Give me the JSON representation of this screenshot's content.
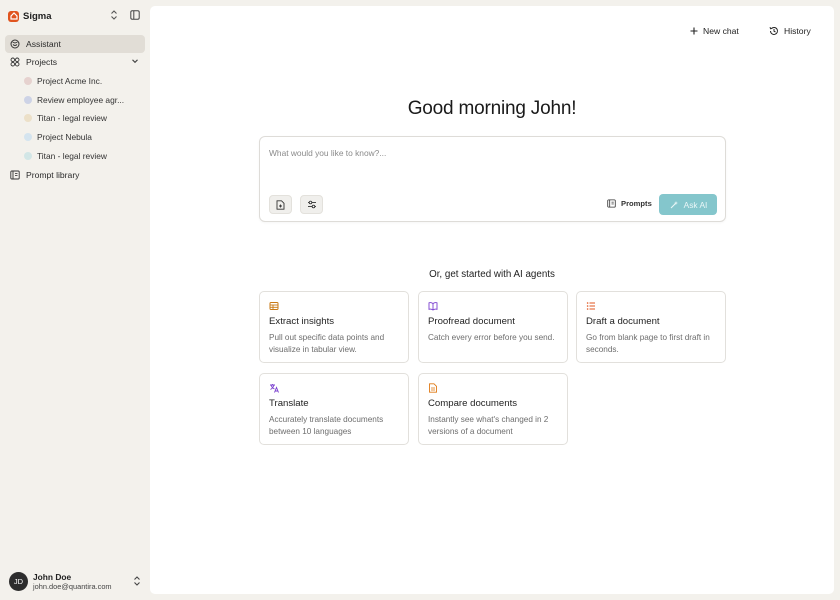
{
  "workspace": {
    "name": "Sigma",
    "logo_color": "#e0541f"
  },
  "sidebar": {
    "assistant_label": "Assistant",
    "projects_label": "Projects",
    "projects": [
      {
        "label": "Project Acme Inc.",
        "color": "#e6d2cf"
      },
      {
        "label": "Review employee agr...",
        "color": "#cdd3e6"
      },
      {
        "label": "Titan - legal review",
        "color": "#ece0c8"
      },
      {
        "label": "Project Nebula",
        "color": "#d4e4ef"
      },
      {
        "label": "Titan - legal review",
        "color": "#d2e6e6"
      }
    ],
    "prompt_library_label": "Prompt library"
  },
  "user": {
    "initials": "JD",
    "name": "John Doe",
    "email": "john.doe@quantira.com"
  },
  "header": {
    "new_chat_label": "New chat",
    "history_label": "History"
  },
  "greeting": "Good morning John!",
  "prompt": {
    "placeholder": "What would you like to know?...",
    "prompts_label": "Prompts",
    "ask_label": "Ask AI",
    "ask_color": "#84c6cc"
  },
  "agents": {
    "heading": "Or, get started with AI agents",
    "cards": [
      {
        "title": "Extract insights",
        "desc": "Pull out specific data points and visualize in tabular view.",
        "icon": "table-icon",
        "icon_color": "#c97a16"
      },
      {
        "title": "Proofread document",
        "desc": "Catch every error before you send.",
        "icon": "book-icon",
        "icon_color": "#7a3fcf"
      },
      {
        "title": "Draft a document",
        "desc": "Go from blank page to first draft in seconds.",
        "icon": "list-icon",
        "icon_color": "#e0541f"
      },
      {
        "title": "Translate",
        "desc": "Accurately translate documents between 10 languages",
        "icon": "translate-icon",
        "icon_color": "#7a3fcf"
      },
      {
        "title": "Compare documents",
        "desc": "Instantly see what's changed in 2 versions of a document",
        "icon": "document-icon",
        "icon_color": "#e07a16"
      }
    ]
  }
}
